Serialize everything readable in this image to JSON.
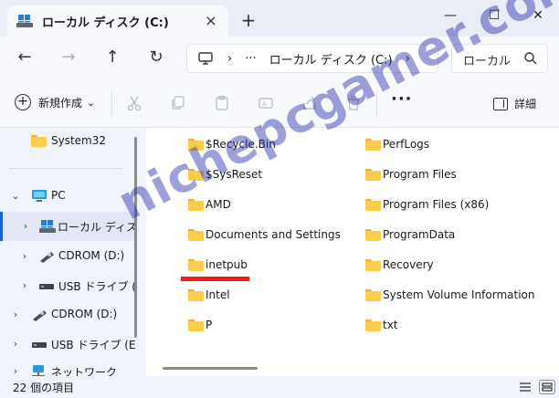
{
  "window": {
    "tab_title": "ローカル ディスク (C:)",
    "close_tab": "×",
    "new_tab": "+",
    "minimize": "—",
    "maximize": "☐",
    "close": "✕"
  },
  "nav": {
    "back": "←",
    "forward": "→",
    "up": "↑",
    "refresh": "↻",
    "address": {
      "sep1": "›",
      "ellipsis": "···",
      "location": "ローカル ディスク (C:)",
      "sep2": "›"
    },
    "search_placeholder": "ローカル"
  },
  "toolbar": {
    "new_label": "新規作成",
    "new_chevron": "⌄",
    "more": "···",
    "details_label": "詳細"
  },
  "sidebar": {
    "items": [
      {
        "label": "System32"
      },
      {
        "label": "PC",
        "chev": "⌄"
      },
      {
        "label": "ローカル ディスク",
        "chev": "›"
      },
      {
        "label": "CDROM (D:)",
        "chev": "›"
      },
      {
        "label": "USB ドライブ (E:)",
        "chev": "›"
      },
      {
        "label": "CDROM (D:)",
        "chev": "›"
      },
      {
        "label": "USB ドライブ (E:)",
        "chev": "›"
      },
      {
        "label": "ネットワーク",
        "chev": "›"
      }
    ]
  },
  "files": {
    "left": [
      "$Recycle.Bin",
      "$SysReset",
      "AMD",
      "Documents and Settings",
      "inetpub",
      "Intel",
      "P"
    ],
    "right": [
      "PerfLogs",
      "Program Files",
      "Program Files (x86)",
      "ProgramData",
      "Recovery",
      "System Volume Information",
      "txt"
    ]
  },
  "watermark": "nichepcgamer.com",
  "status": {
    "item_count": "22 個の項目"
  },
  "colors": {
    "accent": "#1d63c9",
    "folder": "#f9cc4c",
    "highlight": "#ff1a1a"
  }
}
